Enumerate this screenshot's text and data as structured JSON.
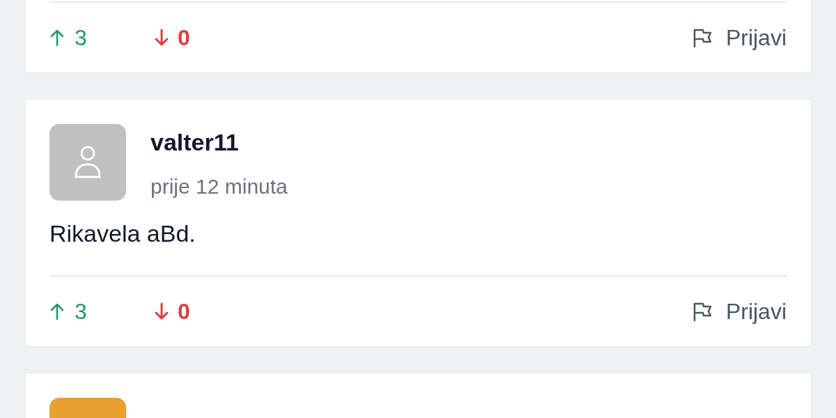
{
  "posts": [
    {
      "upvotes": "3",
      "downvotes": "0",
      "report_label": "Prijavi"
    },
    {
      "color": "#c0c0c0",
      "author": "valter11",
      "time": "prije 12 minuta",
      "body": "Rikavela aBd.",
      "upvotes": "3",
      "downvotes": "0",
      "report_label": "Prijavi"
    },
    {
      "color": "#e8a02e"
    }
  ]
}
